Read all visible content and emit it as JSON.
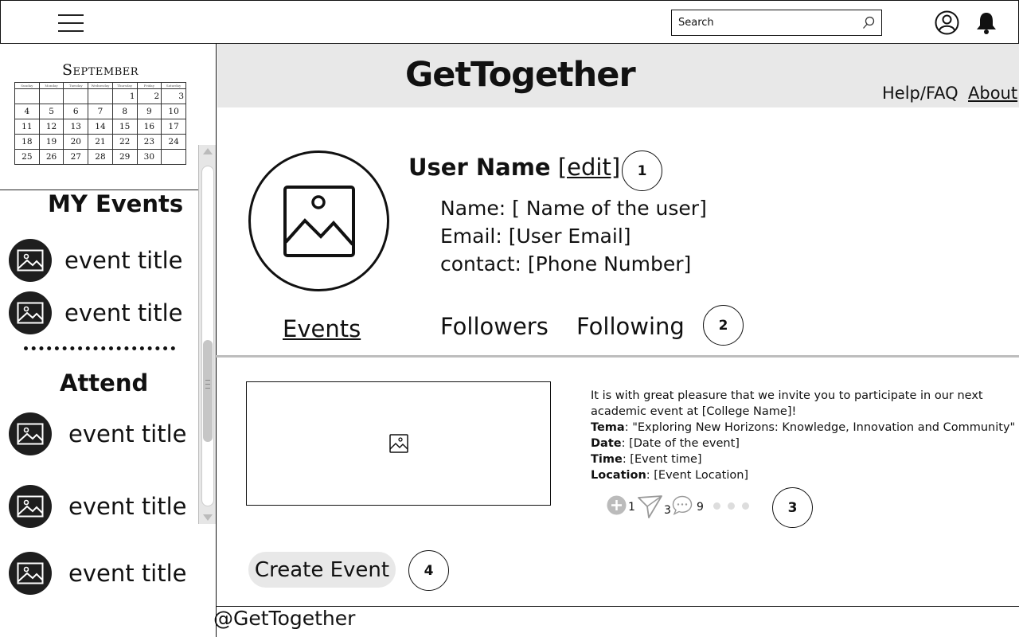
{
  "topbar": {
    "search_placeholder": "Search"
  },
  "calendar": {
    "month": "September",
    "weekdays": [
      "Sunday",
      "Monday",
      "Tuesday",
      "Wednesday",
      "Thursday",
      "Friday",
      "Saturday"
    ],
    "weeks": [
      [
        "",
        "",
        "",
        "",
        "1",
        "2",
        "3"
      ],
      [
        "4",
        "5",
        "6",
        "7",
        "8",
        "9",
        "10"
      ],
      [
        "11",
        "12",
        "13",
        "14",
        "15",
        "16",
        "17"
      ],
      [
        "18",
        "19",
        "20",
        "21",
        "22",
        "23",
        "24"
      ],
      [
        "25",
        "26",
        "27",
        "28",
        "29",
        "30",
        ""
      ]
    ]
  },
  "sidebar": {
    "my_events_heading": "MY Events",
    "my_events": [
      {
        "title": "event title"
      },
      {
        "title": "event title"
      }
    ],
    "attend_heading": "Attend",
    "attend_events": [
      {
        "title": "event title"
      },
      {
        "title": "event title"
      },
      {
        "title": "event title"
      }
    ]
  },
  "header": {
    "app_title": "GetTogether",
    "help_link": "Help/FAQ",
    "about_link": "About"
  },
  "profile": {
    "username": "User Name",
    "edit_label": "[edit]",
    "name_line": "Name:  [ Name of the user]",
    "email_line": "Email: [User Email]",
    "contact_line": "contact: [Phone Number]"
  },
  "tabs": {
    "events": "Events",
    "followers": "Followers",
    "following": "Following"
  },
  "badges": {
    "b1": "1",
    "b2": "2",
    "b3": "3",
    "b4": "4"
  },
  "event_card": {
    "intro": "It is with great pleasure that we invite you to participate in our next academic event at [College Name]!",
    "tema_label": "Tema",
    "tema_value": ": \"Exploring New Horizons: Knowledge, Innovation and Community\"",
    "date_label": "Date",
    "date_value": ": [Date of the event]",
    "time_label": "Time",
    "time_value": ": [Event time]",
    "location_label": "Location",
    "location_value": ": [Event Location]",
    "add_count": "1",
    "share_count": "3",
    "comment_count": "9"
  },
  "create_event_label": "Create Event",
  "footer": {
    "handle": "@GetTogether"
  },
  "colors": {
    "header_band": "#e8e8e8",
    "event_icon_bg": "#1e1e1e",
    "tab_divider": "#bdbdbd"
  }
}
